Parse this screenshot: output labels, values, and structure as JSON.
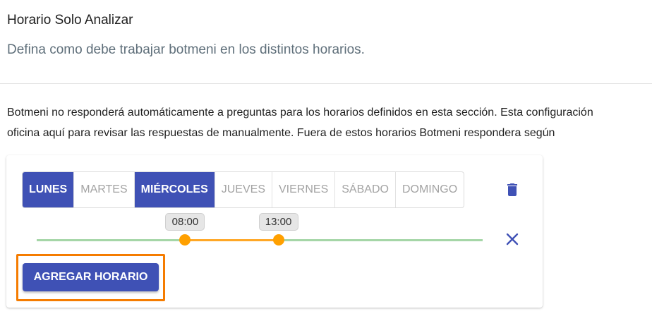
{
  "section": {
    "title": "Horario Solo Analizar",
    "subtitle": "Defina como debe trabajar botmeni en los distintos horarios."
  },
  "description": {
    "line1": "Botmeni no responderá automáticamente a preguntas para los horarios definidos en esta sección. Esta configuración",
    "line2": "oficina aquí para revisar las respuestas de manualmente. Fuera de estos horarios Botmeni respondera según"
  },
  "schedule": {
    "days": [
      {
        "label": "LUNES",
        "selected": true
      },
      {
        "label": "MARTES",
        "selected": false
      },
      {
        "label": "MIÉRCOLES",
        "selected": true
      },
      {
        "label": "JUEVES",
        "selected": false
      },
      {
        "label": "VIERNES",
        "selected": false
      },
      {
        "label": "SÁBADO",
        "selected": false
      },
      {
        "label": "DOMINGO",
        "selected": false
      }
    ],
    "range": {
      "start_label": "08:00",
      "end_label": "13:00",
      "start_fraction": 0.333,
      "end_fraction": 0.542
    },
    "add_button_label": "AGREGAR HORARIO",
    "icons": {
      "delete": "trash-icon",
      "remove": "close-icon"
    }
  },
  "colors": {
    "primary": "#3f51b5",
    "highlight": "#f57c00",
    "range": "#ffa726",
    "track": "#a5d6a7"
  }
}
